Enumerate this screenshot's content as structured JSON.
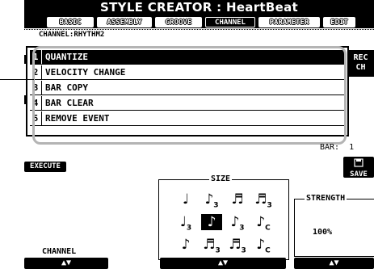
{
  "window": {
    "title": "STYLE CREATOR : HeartBeat"
  },
  "tabs": [
    {
      "label": "BASIC"
    },
    {
      "label": "ASSEMBLY"
    },
    {
      "label": "GROOVE"
    },
    {
      "label": "CHANNEL"
    },
    {
      "label": "PARAMETER"
    },
    {
      "label": "EDIT"
    }
  ],
  "channel_label": "CHANNEL:RHYTHM2",
  "menu": [
    {
      "num": "1",
      "label": "QUANTIZE"
    },
    {
      "num": "2",
      "label": "VELOCITY CHANGE"
    },
    {
      "num": "3",
      "label": "BAR COPY"
    },
    {
      "num": "4",
      "label": "BAR CLEAR"
    },
    {
      "num": "5",
      "label": "REMOVE EVENT"
    }
  ],
  "rec_ch": {
    "line1": "REC",
    "line2": "CH"
  },
  "bar": {
    "label": "BAR:",
    "value": "1"
  },
  "execute_label": "EXECUTE",
  "save_label": "SAVE",
  "size": {
    "label": "SIZE",
    "notes": [
      {
        "symbol": "♩",
        "sub": ""
      },
      {
        "symbol": "♪",
        "sub": "3"
      },
      {
        "symbol": "♬",
        "sub": ""
      },
      {
        "symbol": "♬",
        "sub": "3"
      },
      {
        "symbol": "♩",
        "sub": "3"
      },
      {
        "symbol": "♪",
        "sub": ""
      },
      {
        "symbol": "♪",
        "sub": "3"
      },
      {
        "symbol": "♪",
        "sub": "C"
      },
      {
        "symbol": "♪",
        "sub": ""
      },
      {
        "symbol": "♬",
        "sub": "3"
      },
      {
        "symbol": "♬",
        "sub": "3"
      },
      {
        "symbol": "♪",
        "sub": "C"
      }
    ]
  },
  "strength": {
    "label": "STRENGTH",
    "value": "100%"
  },
  "channel_footer": "CHANNEL",
  "updown_glyph": "▲▼"
}
